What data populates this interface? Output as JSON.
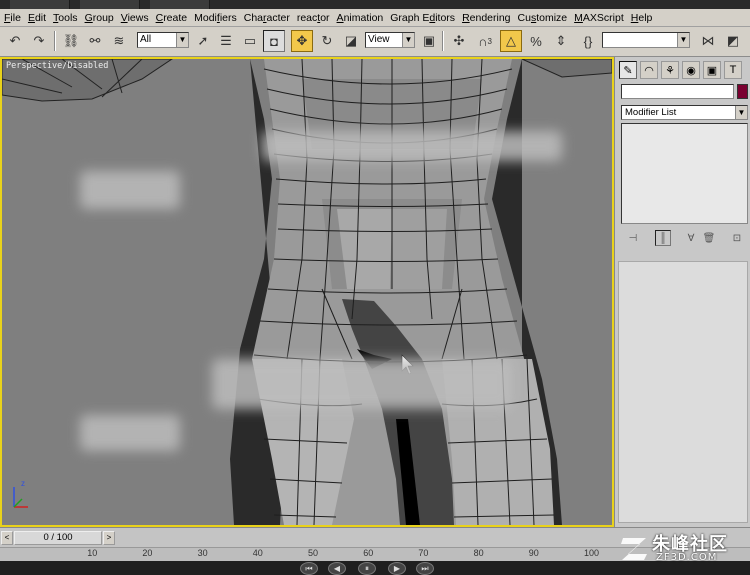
{
  "menu": {
    "items": [
      {
        "pre": "",
        "u": "F",
        "post": "ile"
      },
      {
        "pre": "",
        "u": "E",
        "post": "dit"
      },
      {
        "pre": "",
        "u": "T",
        "post": "ools"
      },
      {
        "pre": "",
        "u": "G",
        "post": "roup"
      },
      {
        "pre": "",
        "u": "V",
        "post": "iews"
      },
      {
        "pre": "",
        "u": "C",
        "post": "reate"
      },
      {
        "pre": "Modi",
        "u": "f",
        "post": "iers"
      },
      {
        "pre": "Cha",
        "u": "r",
        "post": "acter"
      },
      {
        "pre": "reac",
        "u": "t",
        "post": "or"
      },
      {
        "pre": "",
        "u": "A",
        "post": "nimation"
      },
      {
        "pre": "Graph E",
        "u": "d",
        "post": "itors"
      },
      {
        "pre": "",
        "u": "R",
        "post": "endering"
      },
      {
        "pre": "Cu",
        "u": "s",
        "post": "tomize"
      },
      {
        "pre": "",
        "u": "M",
        "post": "AXScript"
      },
      {
        "pre": "",
        "u": "H",
        "post": "elp"
      }
    ]
  },
  "toolbar": {
    "selection_filter": "All",
    "ref_coord_system": "View",
    "snaps_label": "3",
    "named_selection": ""
  },
  "viewport": {
    "label": "Perspective/Disabled",
    "axis_z": "z"
  },
  "command_panel": {
    "modifier_list": "Modifier List",
    "object_color": "#7a0030"
  },
  "timeline": {
    "frame_display": "0 / 100",
    "ticks": [
      "10",
      "20",
      "30",
      "40",
      "50",
      "60",
      "70",
      "80",
      "90",
      "100"
    ]
  },
  "watermark": {
    "cn": "朱峰社区",
    "en": "ZF3D.COM"
  }
}
